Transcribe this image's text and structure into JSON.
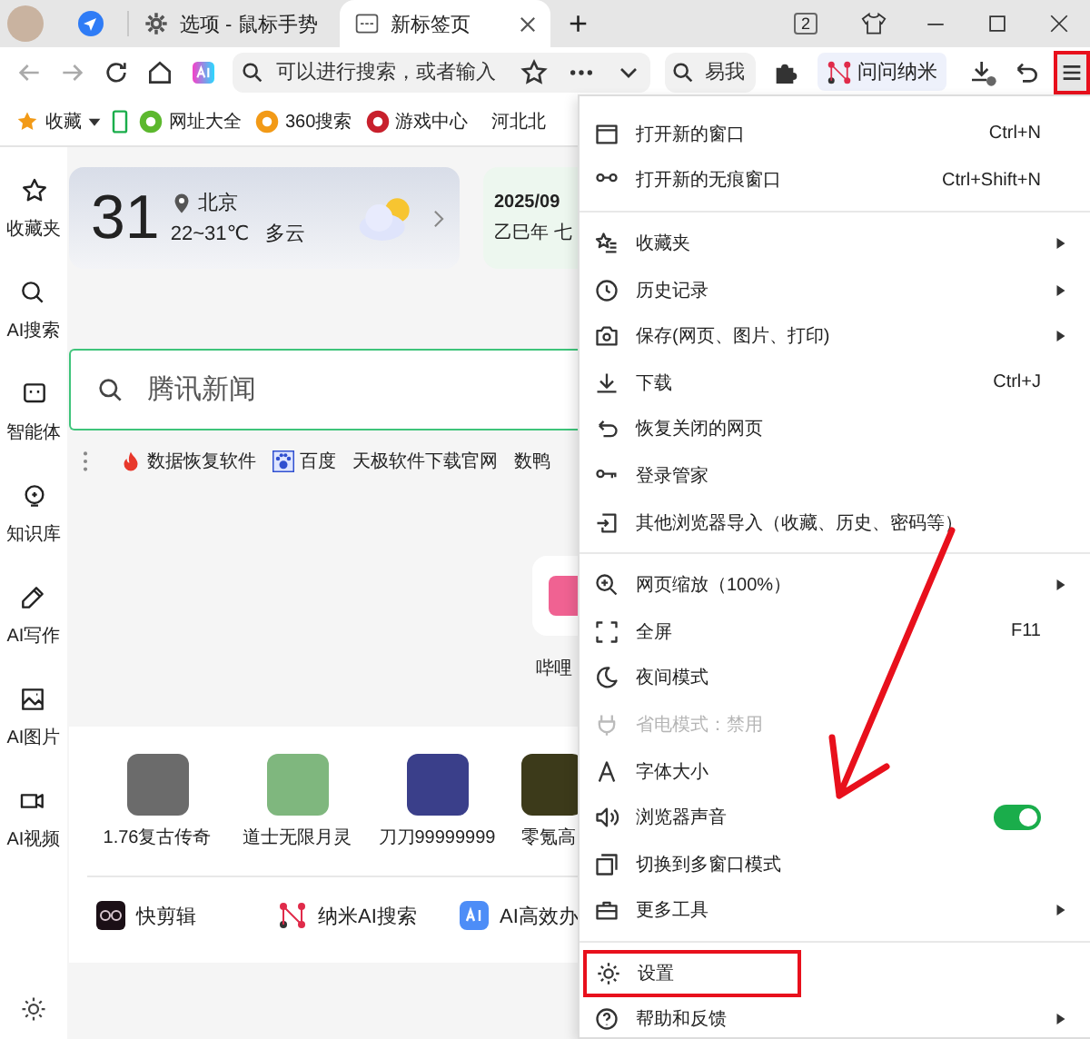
{
  "tabs": [
    {
      "label": "选项 - 鼠标手势",
      "selected": false
    },
    {
      "label": "新标签页",
      "selected": true
    }
  ],
  "tab_count": "2",
  "new_tab": "+",
  "address": {
    "placeholder": "可以进行搜索，或者输入"
  },
  "search_box": {
    "placeholder": "易我"
  },
  "ai_chip": "问问纳米",
  "menu_button": {
    "highlighted": true
  },
  "bookmarks": [
    {
      "label": "收藏",
      "kind": "folder"
    },
    {
      "kind": "device"
    },
    {
      "label": "网址大全",
      "kind": "site"
    },
    {
      "label": "360搜索",
      "kind": "site"
    },
    {
      "label": "游戏中心",
      "kind": "site"
    },
    {
      "label": "河北北",
      "kind": "text"
    }
  ],
  "sidebar": {
    "items": [
      {
        "label": "收藏夹"
      },
      {
        "label": "AI搜索"
      },
      {
        "label": "智能体"
      },
      {
        "label": "知识库"
      },
      {
        "label": "AI写作"
      },
      {
        "label": "AI图片"
      },
      {
        "label": "AI视频"
      }
    ]
  },
  "weather": {
    "temperature": "31",
    "city": "北京",
    "range": "22~31℃",
    "condition": "多云"
  },
  "date_card": {
    "date": "2025/09",
    "lunar": "乙巳年 七"
  },
  "search": {
    "placeholder": "腾讯新闻"
  },
  "quick_links": [
    "数据恢复软件",
    "百度",
    "天极软件下载官网",
    "数鸭"
  ],
  "site_tile": {
    "label": "哔哩"
  },
  "games": [
    "1.76复古传奇",
    "道士无限月灵",
    "刀刀99999999",
    "零氪高"
  ],
  "apps": [
    "快剪辑",
    "纳米AI搜索",
    "AI高效办"
  ],
  "menu": {
    "groups": [
      {
        "items": [
          {
            "kind": "item",
            "label": "打开新的窗口",
            "shortcut": "Ctrl+N",
            "submenu": false,
            "disabled": false,
            "highlighted": false
          },
          {
            "kind": "item",
            "label": "打开新的无痕窗口",
            "shortcut": "Ctrl+Shift+N",
            "submenu": false,
            "disabled": false,
            "highlighted": false
          }
        ]
      },
      {
        "items": [
          {
            "kind": "item",
            "label": "收藏夹",
            "submenu": true,
            "disabled": false,
            "highlighted": false
          },
          {
            "kind": "item",
            "label": "历史记录",
            "submenu": true,
            "disabled": false,
            "highlighted": false
          },
          {
            "kind": "item",
            "label": "保存(网页、图片、打印)",
            "submenu": true,
            "disabled": false,
            "highlighted": false
          },
          {
            "kind": "item",
            "label": "下载",
            "shortcut": "Ctrl+J",
            "submenu": false,
            "disabled": false,
            "highlighted": false
          },
          {
            "kind": "item",
            "label": "恢复关闭的网页",
            "submenu": false,
            "disabled": false,
            "highlighted": false
          },
          {
            "kind": "item",
            "label": "登录管家",
            "submenu": false,
            "disabled": false,
            "highlighted": false
          },
          {
            "kind": "item",
            "label": "其他浏览器导入（收藏、历史、密码等）",
            "submenu": false,
            "disabled": false,
            "highlighted": false
          }
        ]
      },
      {
        "items": [
          {
            "kind": "item",
            "label": "网页缩放（100%）",
            "submenu": true,
            "disabled": false,
            "highlighted": false
          },
          {
            "kind": "item",
            "label": "全屏",
            "shortcut": "F11",
            "submenu": false,
            "disabled": false,
            "highlighted": false
          },
          {
            "kind": "item",
            "label": "夜间模式",
            "submenu": false,
            "disabled": false,
            "highlighted": false
          },
          {
            "kind": "item",
            "label": "省电模式：禁用",
            "submenu": false,
            "disabled": true,
            "highlighted": false
          },
          {
            "kind": "item",
            "label": "字体大小",
            "submenu": false,
            "disabled": false,
            "highlighted": false
          },
          {
            "kind": "toggle",
            "label": "浏览器声音",
            "on": true,
            "submenu": false,
            "disabled": false,
            "highlighted": false
          },
          {
            "kind": "item",
            "label": "切换到多窗口模式",
            "submenu": false,
            "disabled": false,
            "highlighted": false
          },
          {
            "kind": "item",
            "label": "更多工具",
            "submenu": true,
            "disabled": false,
            "highlighted": false
          }
        ]
      },
      {
        "items": [
          {
            "kind": "item",
            "label": "设置",
            "submenu": false,
            "disabled": false,
            "highlighted": true
          },
          {
            "kind": "item",
            "label": "帮助和反馈",
            "submenu": true,
            "disabled": false,
            "highlighted": false
          }
        ]
      }
    ]
  }
}
